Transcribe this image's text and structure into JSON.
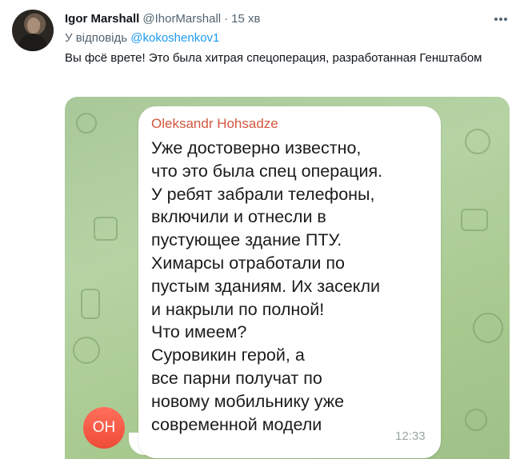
{
  "tweet": {
    "display_name": "Igor Marshall",
    "handle": "@IhorMarshall",
    "separator": "·",
    "time": "15 хв",
    "reply_prefix": "У відповідь",
    "reply_mention": "@kokoshenkov1",
    "text": "Вы фсё врете! Это была хитрая спецоперация, разработанная Генштабом"
  },
  "icons": {
    "more": "more-horizontal-icon",
    "avatar": "user-avatar"
  },
  "media": {
    "sender_name": "Oleksandr Hohsadze",
    "message": "Уже достоверно известно,\nчто это была спец операция.\nУ ребят забрали телефоны,\nвключили и отнесли в\nпустующее здание ПТУ.\nХимарсы отработали по\nпустым зданиям. Их засекли\nи накрыли по полной!\nЧто имеем?\n Суровикин герой, а\nвсе парни получат по\nновому мобильнику уже\nсовременной модели",
    "message_time": "12:33",
    "sender_initials": "OH",
    "colors": {
      "sender_name": "#d2583f",
      "avatar_bg": "#ee4b37",
      "chat_bg": "#b6d3a4",
      "mention": "#1d9bf0"
    }
  }
}
